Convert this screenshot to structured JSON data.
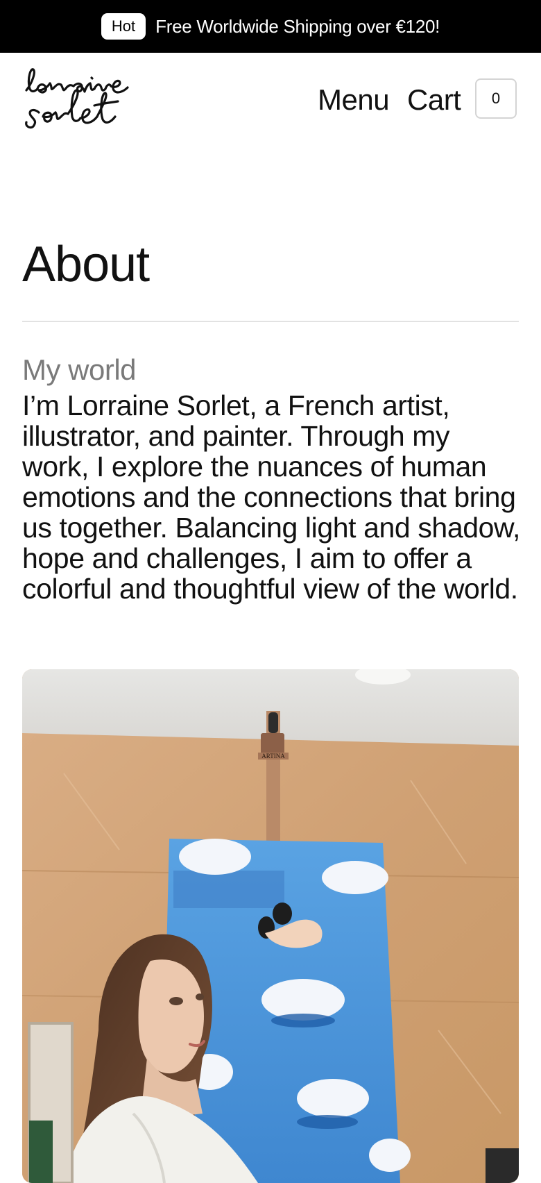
{
  "announcement": {
    "badge": "Hot",
    "text": "Free Worldwide Shipping over €120!"
  },
  "header": {
    "logo_text": "lorraine sorlet",
    "menu_label": "Menu",
    "cart_label": "Cart",
    "cart_count": "0"
  },
  "page": {
    "title": "About"
  },
  "section": {
    "label": "My world",
    "body": "I’m Lorraine Sorlet, a French artist, illustrator, and painter. Through my work, I explore the nuances of human emotions and the connections that bring us together. Balancing light and shadow, hope and challenges, I aim to offer a colorful and thoughtful view of the world."
  },
  "photo": {
    "easel_brand": "ARTINA"
  },
  "colors": {
    "announcement_bg": "#000000",
    "text": "#111111",
    "muted": "#7a7a7a",
    "divider": "#e2e2e2",
    "kraft_paper": "#d5a77c",
    "canvas_blue": "#4f97dc"
  }
}
